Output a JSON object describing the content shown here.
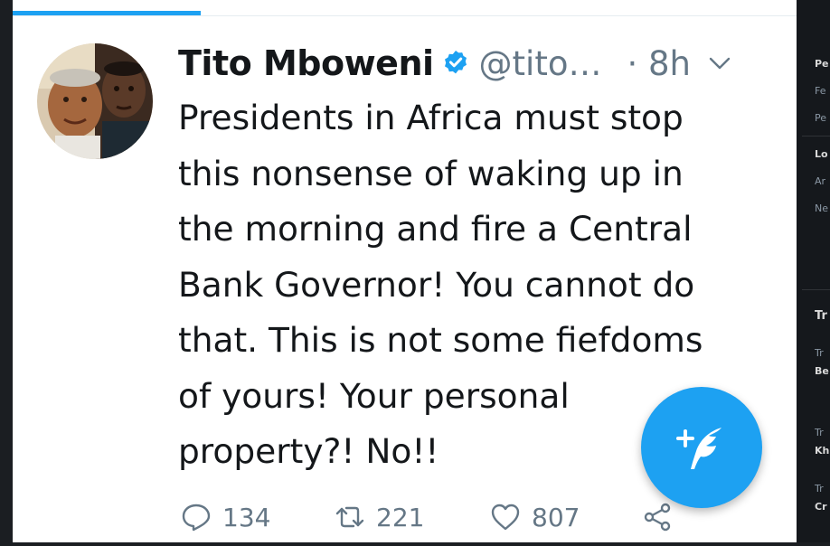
{
  "tweet": {
    "display_name": "Tito Mboweni",
    "handle": "@tito…",
    "time": "· 8h",
    "text": "Presidents in Africa must stop\nthis nonsense of waking up in\nthe morning and fire a Central\nBank Governor! You cannot do\nthat. This is not some fiefdoms\nof yours! Your personal\nproperty?! No!!",
    "replies": "134",
    "retweets": "221",
    "likes": "807"
  },
  "icons": {
    "verified": "verified-badge-icon",
    "caret": "chevron-down-icon",
    "reply": "reply-icon",
    "retweet": "retweet-icon",
    "like": "heart-icon",
    "share": "share-icon",
    "compose": "compose-tweet-icon"
  },
  "sidebar": {
    "fragments": [
      "Pe",
      "Fe",
      "Pe",
      "Lo",
      "Ar",
      "Ne",
      "Tr",
      "Tr",
      "Be",
      "Tr",
      "Kh",
      "Tr",
      "Cr"
    ]
  },
  "colors": {
    "accent": "#1da1f2",
    "text": "#14171a",
    "secondary": "#657786"
  }
}
